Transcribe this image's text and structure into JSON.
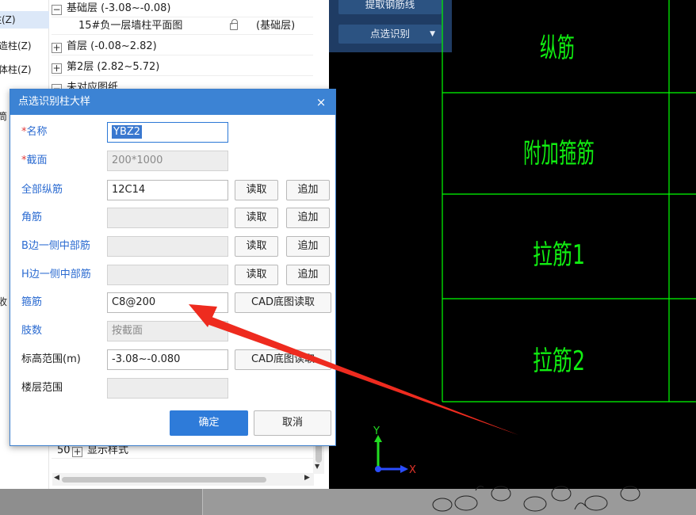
{
  "left_tree": {
    "items": [
      {
        "label": "柱(Z)",
        "selected": true
      },
      {
        "label": "构造柱(Z)",
        "selected": false
      },
      {
        "label": "砌体柱(Z)",
        "selected": false
      },
      {
        "label": "筒",
        "selected": false
      },
      {
        "label": "收",
        "selected": false
      }
    ]
  },
  "layers": {
    "rows": [
      {
        "toggle": "−",
        "label": "基础层 (-3.08~-0.08)"
      },
      {
        "toggle": "",
        "label": "15#负一层墙柱平面图",
        "tag": "(基础层)"
      },
      {
        "toggle": "+",
        "label": "首层 (-0.08~2.82)"
      },
      {
        "toggle": "+",
        "label": "第2层 (2.82~5.72)"
      },
      {
        "toggle": "−",
        "label": "未对应图纸"
      }
    ],
    "bottom_row": {
      "index": "50",
      "toggle": "+",
      "label": "显示样式"
    }
  },
  "toolbar": {
    "extract_label": "提取钢筋线",
    "pick_label": "点选识别",
    "pick_arrow": "▼"
  },
  "cad": {
    "cells": [
      "纵筋",
      "附加箍筋",
      "拉筋1",
      "拉筋2"
    ],
    "axis_x": "X",
    "axis_y": "Y",
    "line_color": "#00ff00",
    "text_color": "#11ee11"
  },
  "dialog": {
    "title": "点选识别柱大样",
    "close": "×",
    "fields": [
      {
        "label": "名称",
        "required": true,
        "value": "YBZ2"
      },
      {
        "label": "截面",
        "required": true,
        "value": "200*1000"
      },
      {
        "label": "全部纵筋",
        "value": "12C14",
        "read": "读取",
        "add": "追加"
      },
      {
        "label": "角筋",
        "value": "",
        "read": "读取",
        "add": "追加"
      },
      {
        "label": "B边一侧中部筋",
        "value": "",
        "read": "读取",
        "add": "追加"
      },
      {
        "label": "H边一侧中部筋",
        "value": "",
        "read": "读取",
        "add": "追加"
      },
      {
        "label": "箍筋",
        "value": "C8@200",
        "cad": "CAD底图读取"
      },
      {
        "label": "肢数",
        "value": "按截面"
      },
      {
        "label": "标高范围(m)",
        "value": "-3.08~-0.080",
        "cad": "CAD底图读取"
      },
      {
        "label": "楼层范围",
        "value": ""
      }
    ],
    "required_mark": "*",
    "ok": "确定",
    "cancel": "取消"
  },
  "annotation": {
    "arrow_color": "#ee2b1f"
  },
  "colors": {
    "accent": "#2e7bd9",
    "dialog_title": "#3c83d4",
    "toolbar": "#1f3c64",
    "label_blue": "#2b6bd1"
  }
}
